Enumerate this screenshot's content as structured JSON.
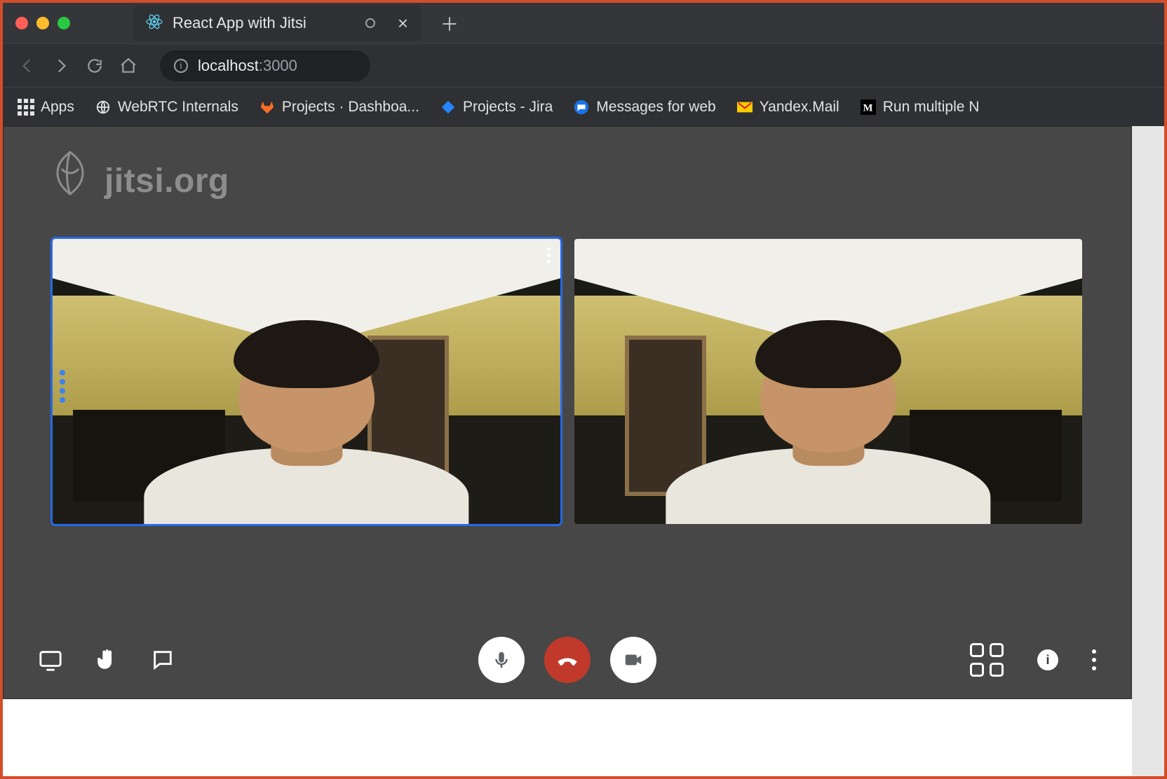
{
  "window": {
    "tab_title": "React App with Jitsi",
    "traffic_lights": [
      "close",
      "minimize",
      "zoom"
    ]
  },
  "toolbar": {
    "back": "Back",
    "forward": "Forward",
    "reload": "Reload",
    "home": "Home",
    "url_prefix": "localhost",
    "url_suffix": ":3000"
  },
  "bookmarks": [
    {
      "icon": "apps-grid-icon",
      "label": "Apps"
    },
    {
      "icon": "globe-icon",
      "label": "WebRTC Internals"
    },
    {
      "icon": "gitlab-icon",
      "label": "Projects · Dashboa..."
    },
    {
      "icon": "jira-icon",
      "label": "Projects - Jira"
    },
    {
      "icon": "messages-icon",
      "label": "Messages for web"
    },
    {
      "icon": "yandex-icon",
      "label": "Yandex.Mail"
    },
    {
      "icon": "medium-icon",
      "label": "Run multiple N"
    }
  ],
  "jitsi": {
    "watermark_text": "jitsi.org",
    "tiles": [
      {
        "active": true,
        "has_menu_dots": true,
        "has_connection_dots": true
      },
      {
        "active": false,
        "has_menu_dots": false,
        "has_connection_dots": false
      }
    ],
    "toolbar": {
      "left": [
        {
          "name": "screen-share-button",
          "icon": "screen-icon"
        },
        {
          "name": "raise-hand-button",
          "icon": "hand-icon"
        },
        {
          "name": "chat-button",
          "icon": "chat-icon"
        }
      ],
      "center": [
        {
          "name": "mute-audio-button",
          "icon": "mic-icon",
          "style": "circle-white"
        },
        {
          "name": "hangup-button",
          "icon": "phone-down-icon",
          "style": "circle-red"
        },
        {
          "name": "mute-video-button",
          "icon": "camera-icon",
          "style": "circle-white"
        }
      ],
      "right": [
        {
          "name": "tile-view-button",
          "icon": "tileview-icon"
        },
        {
          "name": "info-button",
          "icon": "info-icon"
        },
        {
          "name": "more-actions-button",
          "icon": "kebab-icon"
        }
      ]
    }
  },
  "colors": {
    "browser_bg": "#2f3033",
    "jitsi_bg": "#474747",
    "active_border": "#266ae8",
    "hangup": "#c0392b",
    "page_border": "#d24d2a"
  }
}
